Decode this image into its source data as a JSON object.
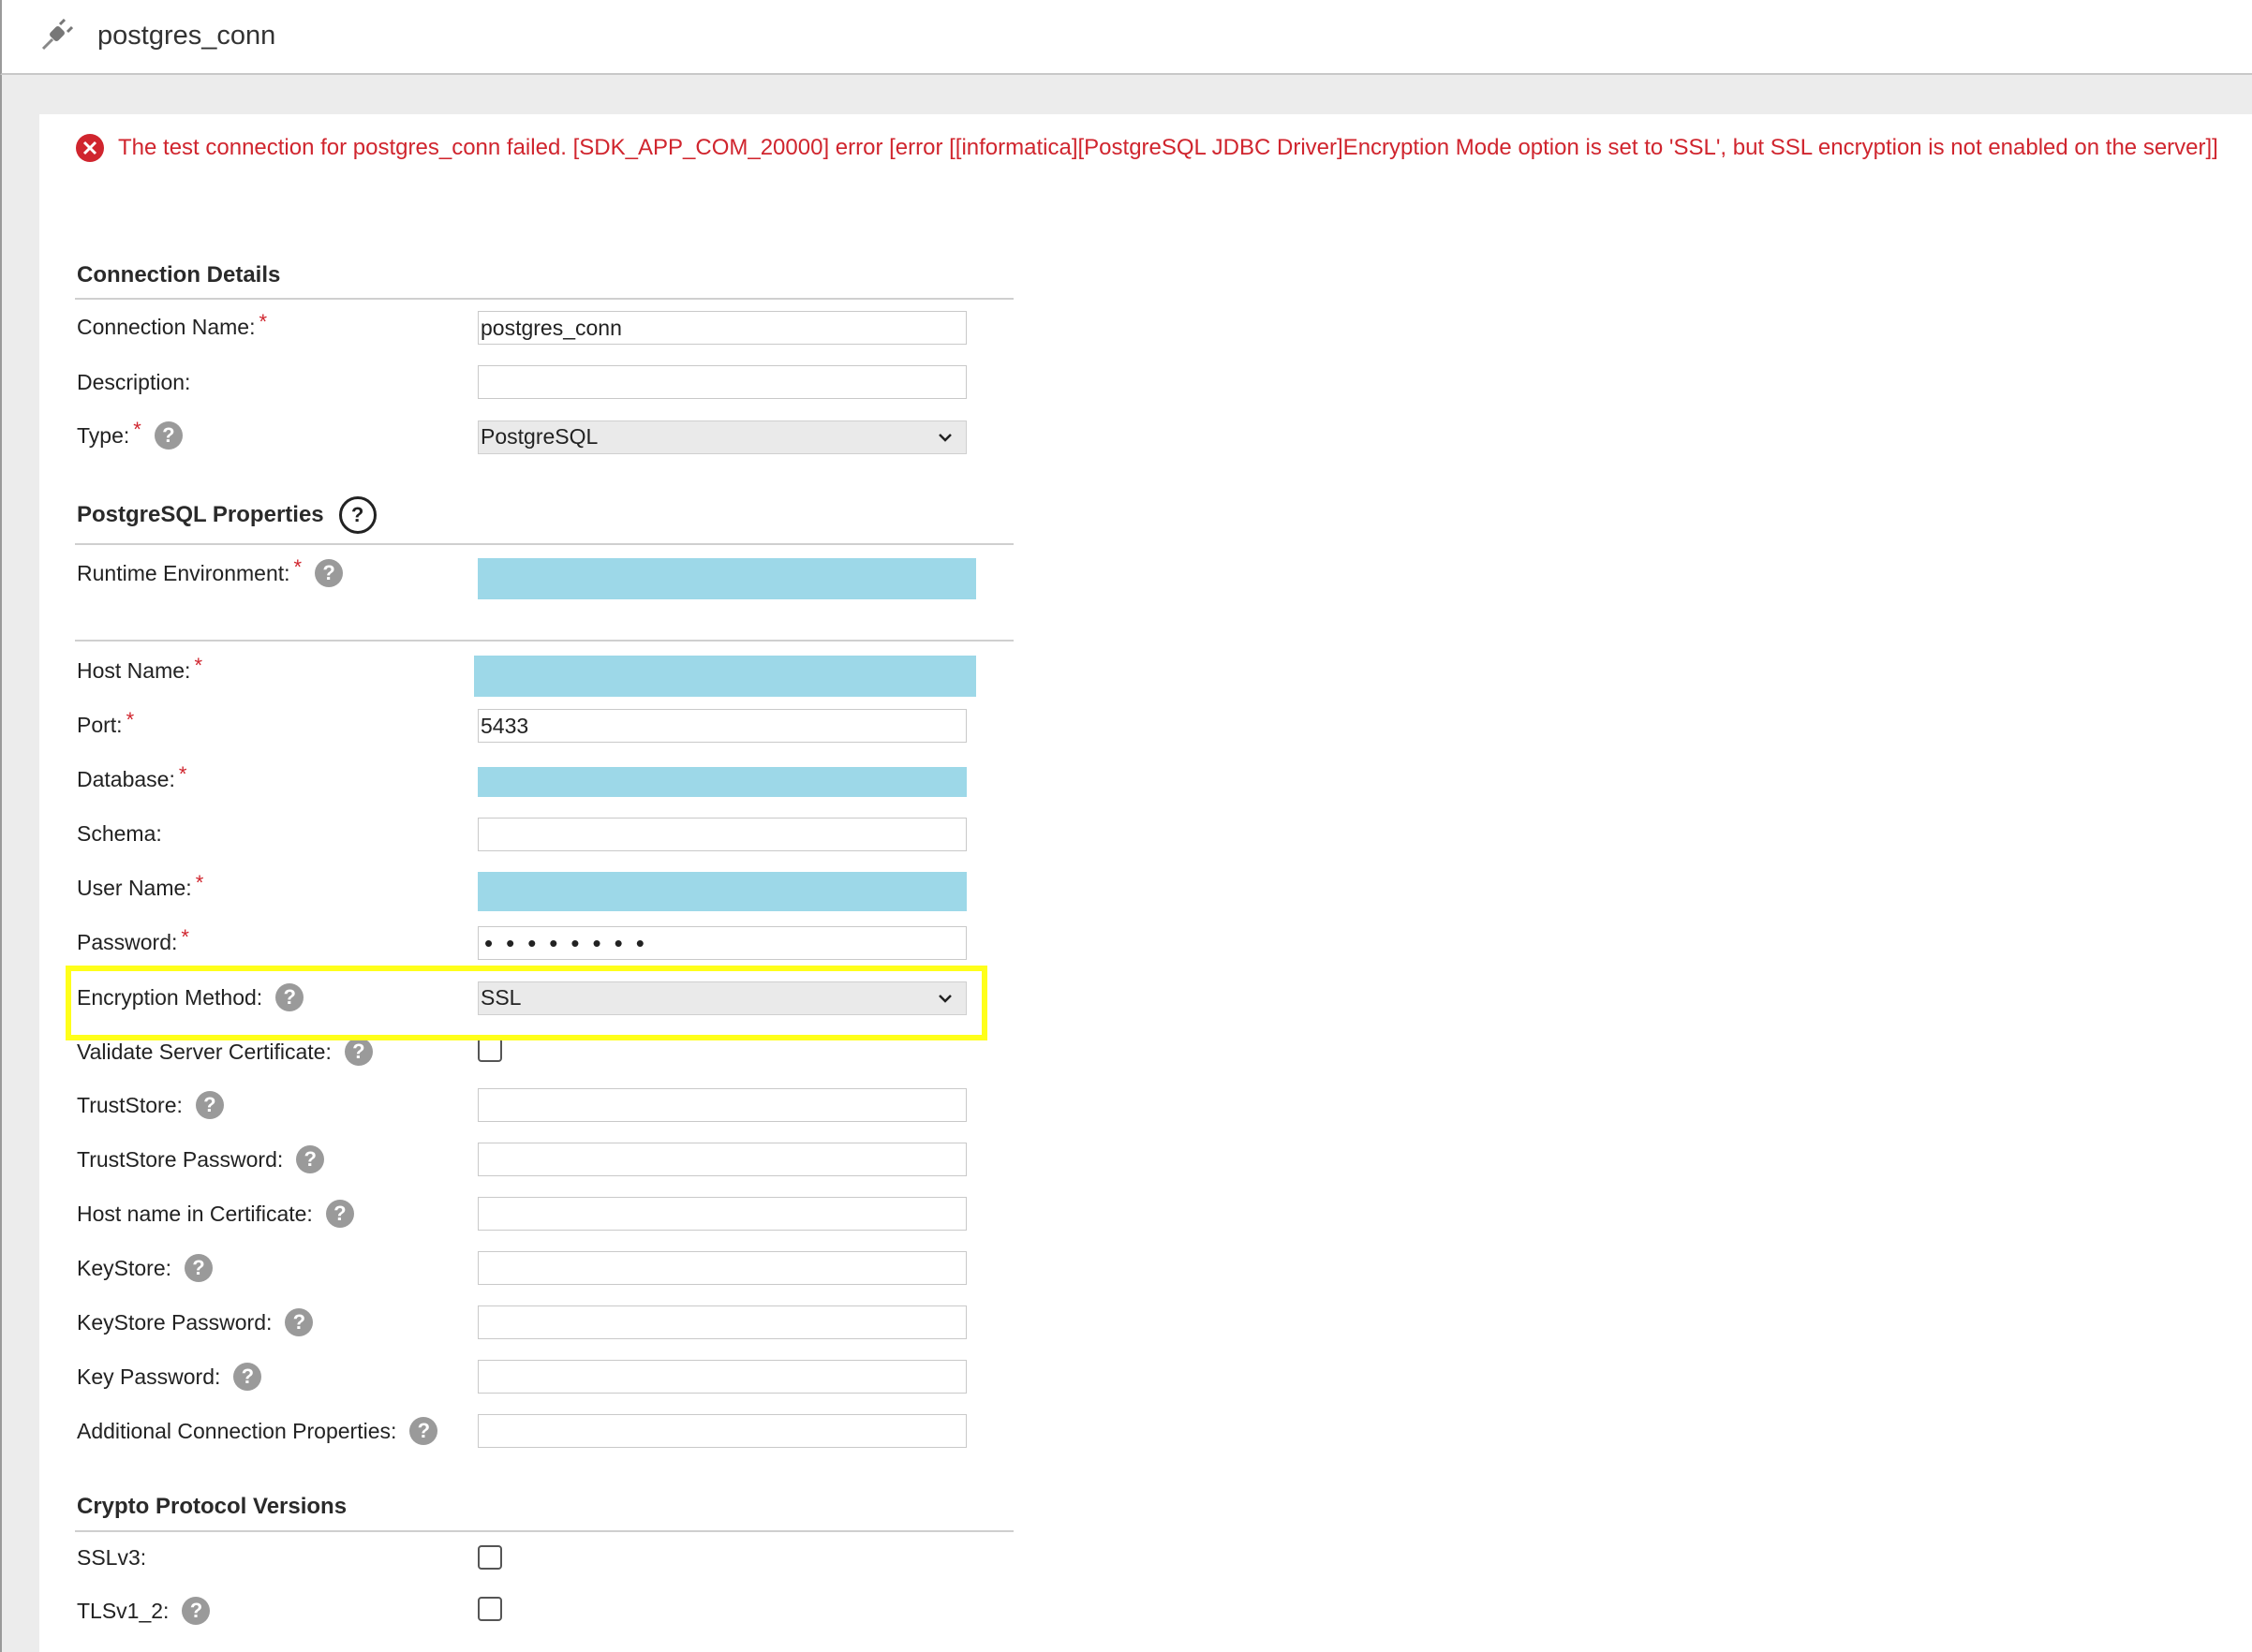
{
  "header": {
    "title": "postgres_conn",
    "icon": "plug-icon"
  },
  "error": {
    "message": "The test connection for postgres_conn failed. [SDK_APP_COM_20000] error [error [[informatica][PostgreSQL JDBC Driver]Encryption Mode option is set to 'SSL', but SSL encryption is not enabled on the server]]",
    "color": "#d0252e"
  },
  "connection_details": {
    "title": "Connection Details",
    "name_label": "Connection Name:",
    "name_value": "postgres_conn",
    "description_label": "Description:",
    "description_value": "",
    "type_label": "Type:",
    "type_value": "PostgreSQL"
  },
  "postgres_properties": {
    "title": "PostgreSQL Properties",
    "runtime_label": "Runtime Environment:",
    "host_label": "Host Name:",
    "port_label": "Port:",
    "port_value": "5433",
    "database_label": "Database:",
    "schema_label": "Schema:",
    "schema_value": "",
    "username_label": "User Name:",
    "password_label": "Password:",
    "password_value": "••••••••",
    "encryption_label": "Encryption Method:",
    "encryption_value": "SSL",
    "validate_cert_label": "Validate Server Certificate:",
    "truststore_label": "TrustStore:",
    "truststore_password_label": "TrustStore Password:",
    "host_in_cert_label": "Host name in Certificate:",
    "keystore_label": "KeyStore:",
    "keystore_password_label": "KeyStore Password:",
    "key_password_label": "Key Password:",
    "additional_props_label": "Additional Connection Properties:"
  },
  "crypto": {
    "title": "Crypto Protocol Versions",
    "sslv3_label": "SSLv3:",
    "tlsv12_label": "TLSv1_2:"
  },
  "colors": {
    "required": "#d0252e",
    "redacted": "#9dd8e8",
    "highlight": "#ffff1a"
  }
}
